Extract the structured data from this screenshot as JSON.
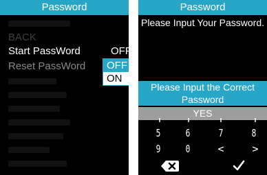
{
  "left_screen": {
    "header_title": "Password",
    "menu": {
      "back": "BACK",
      "start_password": "Start PassWord",
      "reset_password": "Reset PassWord",
      "start_password_value": "OFF"
    },
    "dropdown": {
      "options": [
        "OFF",
        "ON"
      ],
      "selected": "OFF"
    }
  },
  "right_screen": {
    "header_title": "Password",
    "prompt": "Please Input Your Password.",
    "alert": {
      "line1": "Please Input the Correct",
      "line2": "Password"
    },
    "confirm_label": "YES",
    "keypad": {
      "row1": [
        "5",
        "6",
        "7",
        "8"
      ],
      "row2": [
        "9",
        "0",
        "<",
        ">"
      ]
    },
    "backspace_icon": "backspace-icon",
    "confirm_icon": "checkmark-icon"
  },
  "colors": {
    "accent": "#27a6c7",
    "background": "#000000",
    "yes_bar": "#9e9e9e",
    "dim_text": "#3f3f3f",
    "muted_text": "#8a8a8a"
  }
}
